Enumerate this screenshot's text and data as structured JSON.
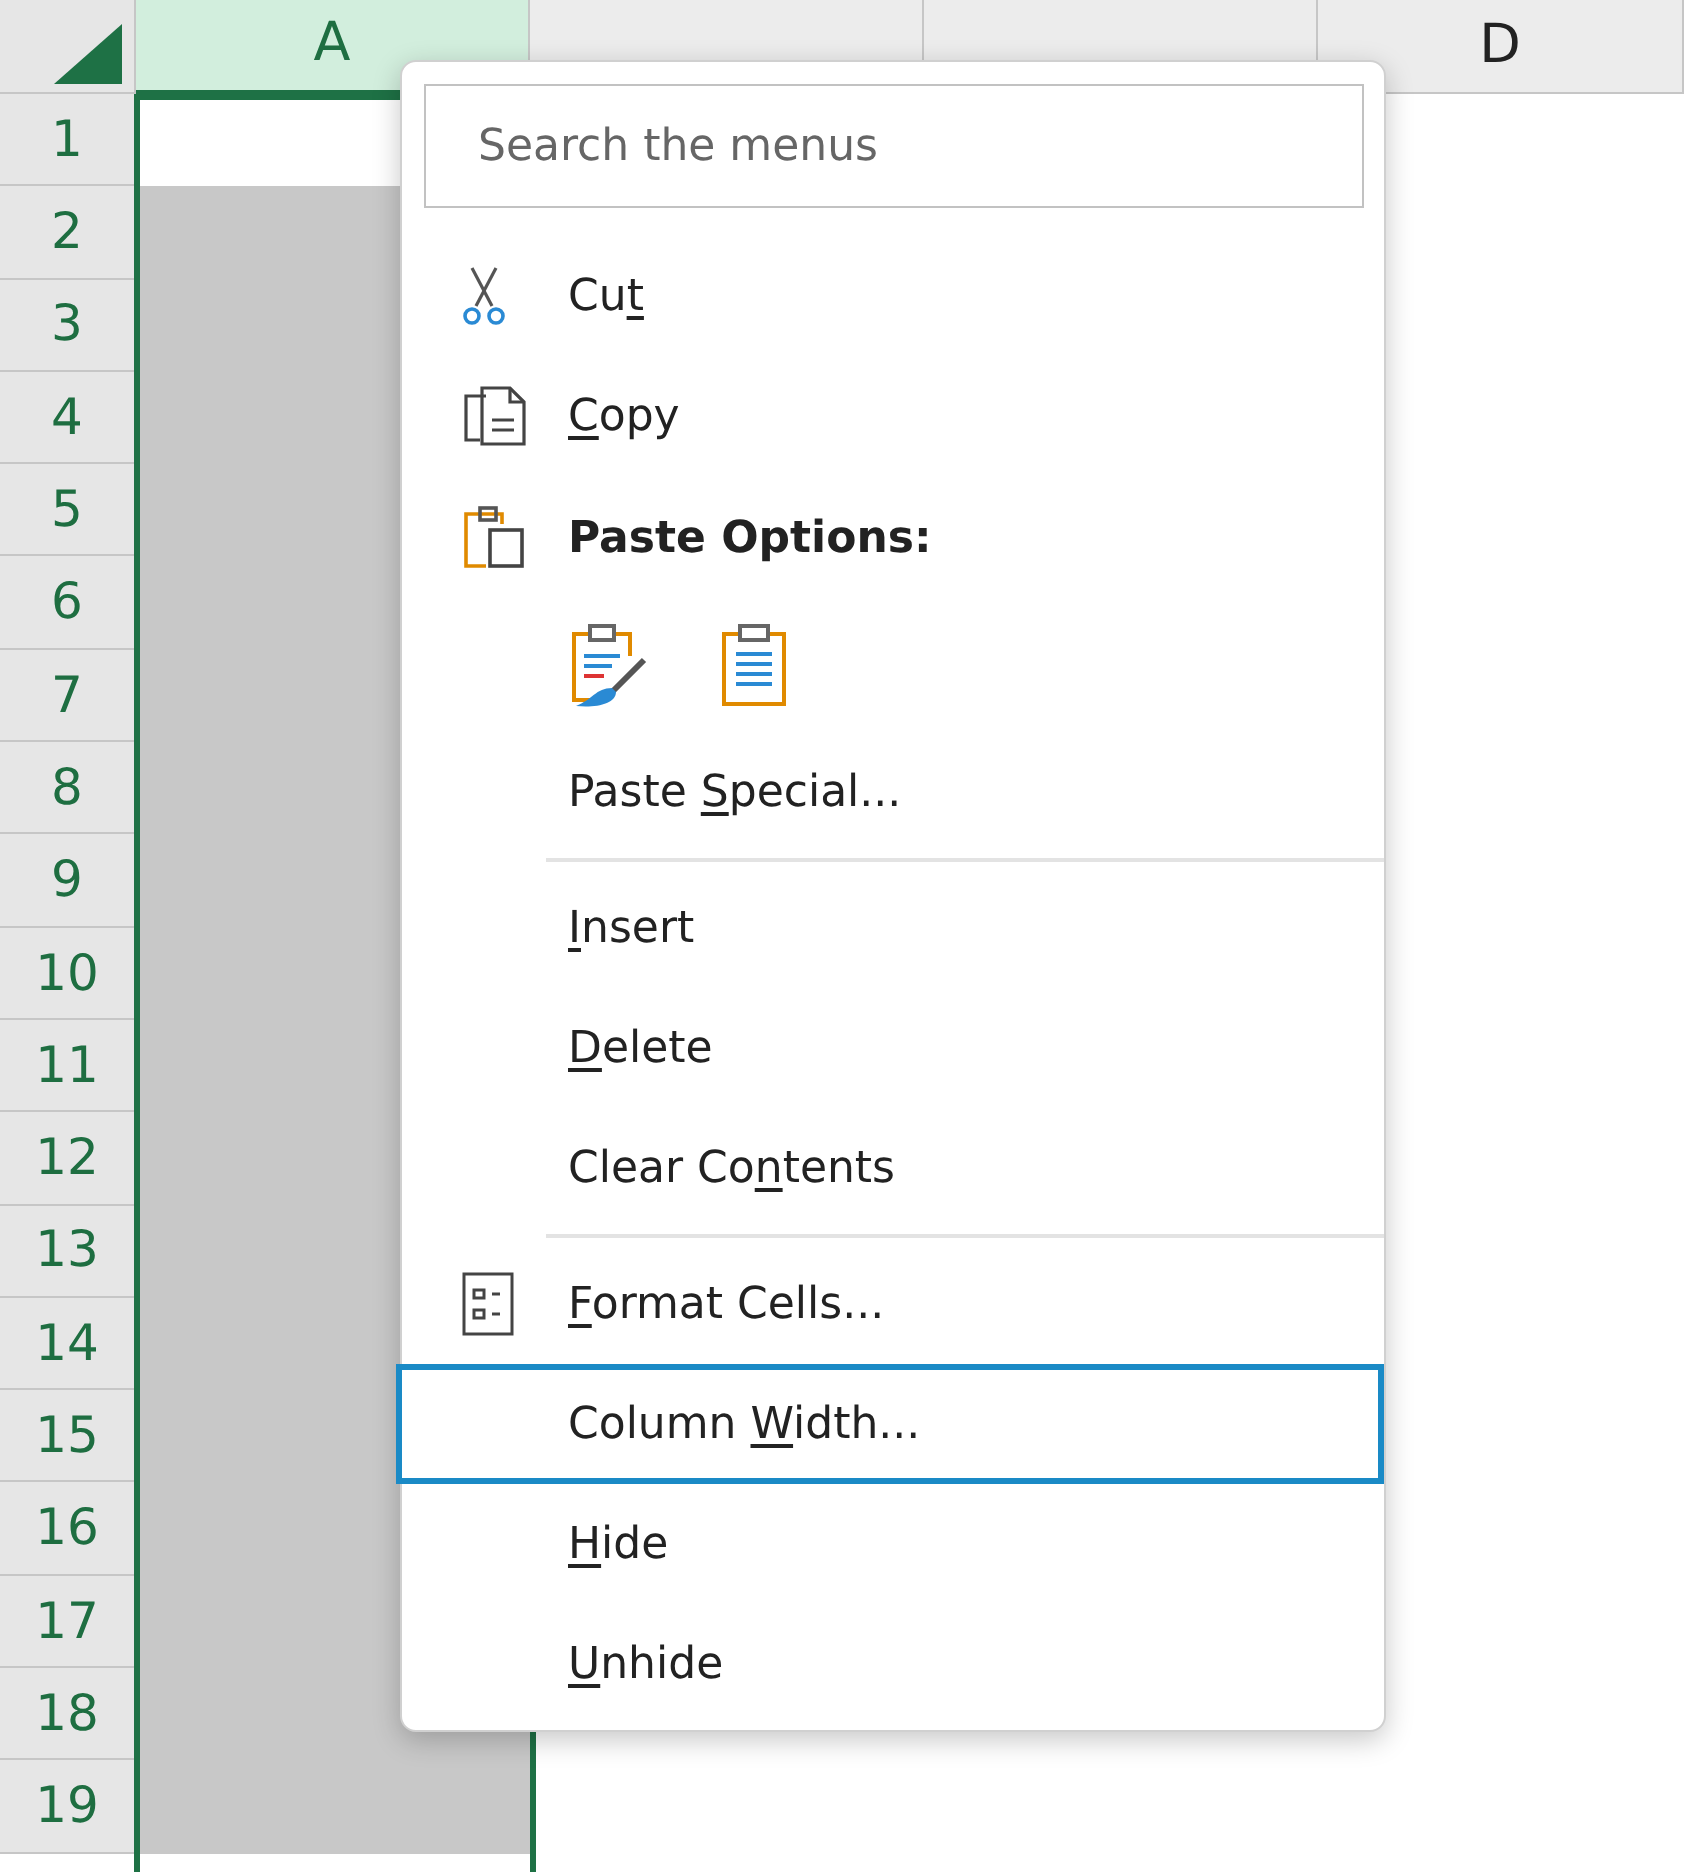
{
  "sheet": {
    "columns": [
      {
        "label": "A",
        "selected": true
      },
      {
        "selected": false
      },
      {
        "selected": false
      },
      {
        "label": "D",
        "selected": false
      }
    ],
    "rows": [
      "1",
      "2",
      "3",
      "4",
      "5",
      "6",
      "7",
      "8",
      "9",
      "10",
      "11",
      "12",
      "13",
      "14",
      "15",
      "16",
      "17",
      "18",
      "19"
    ]
  },
  "context_menu": {
    "search": {
      "placeholder": "Search the menus"
    },
    "items": [
      {
        "kind": "item",
        "label": {
          "pre": "Cu",
          "key": "t"
        },
        "selected": false
      },
      {
        "kind": "item",
        "label": {
          "key": "C",
          "post": "opy"
        },
        "selected": false
      },
      {
        "kind": "header",
        "label": "Paste Options:"
      },
      {
        "kind": "paste_buttons"
      },
      {
        "kind": "item",
        "label": {
          "pre": "Paste ",
          "key": "S",
          "post": "pecial..."
        },
        "selected": false
      },
      {
        "kind": "separator"
      },
      {
        "kind": "item",
        "label": {
          "key": "I",
          "post": "nsert"
        },
        "selected": false
      },
      {
        "kind": "item",
        "label": {
          "key": "D",
          "post": "elete"
        },
        "selected": false
      },
      {
        "kind": "item",
        "label": {
          "pre": "Clear Co",
          "key": "n",
          "post": "tents"
        },
        "selected": false
      },
      {
        "kind": "separator"
      },
      {
        "kind": "item",
        "label": {
          "key": "F",
          "post": "ormat Cells..."
        },
        "selected": false
      },
      {
        "kind": "item",
        "label": {
          "pre": "Column ",
          "key": "W",
          "post": "idth..."
        },
        "selected": true
      },
      {
        "kind": "item",
        "label": {
          "key": "H",
          "post": "ide"
        },
        "selected": false
      },
      {
        "kind": "item",
        "label": {
          "key": "U",
          "post": "nhide"
        },
        "selected": false
      }
    ]
  }
}
